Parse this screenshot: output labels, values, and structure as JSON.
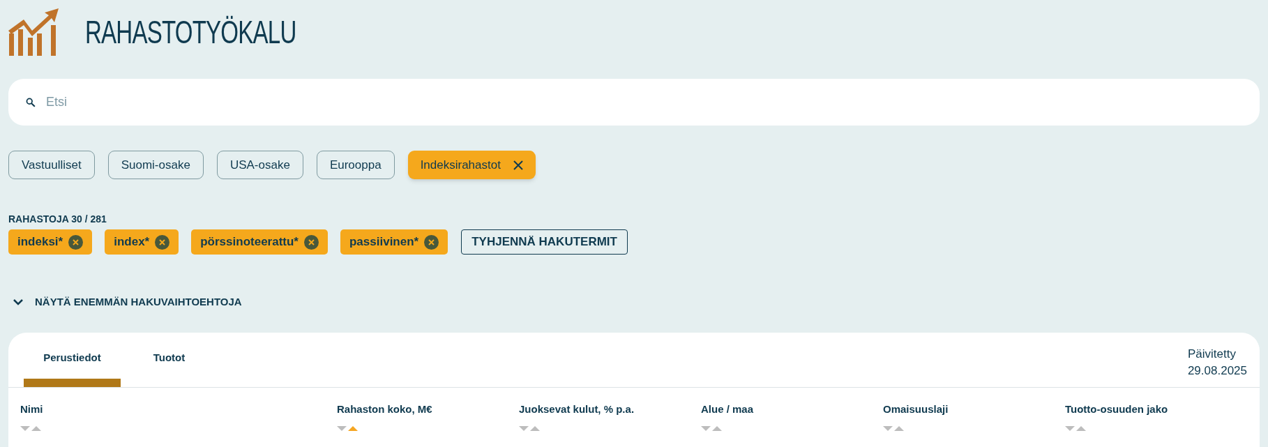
{
  "header": {
    "title": "RAHASTOTYÖKALU"
  },
  "search": {
    "placeholder": "Etsi"
  },
  "quick_filters": [
    {
      "label": "Vastuulliset",
      "selected": false
    },
    {
      "label": "Suomi-osake",
      "selected": false
    },
    {
      "label": "USA-osake",
      "selected": false
    },
    {
      "label": "Eurooppa",
      "selected": false
    },
    {
      "label": "Indeksirahastot",
      "selected": true
    }
  ],
  "result_count": "RAHASTOJA 30 / 281",
  "search_terms": [
    {
      "label": "indeksi*"
    },
    {
      "label": "index*"
    },
    {
      "label": "pörssinoteerattu*"
    },
    {
      "label": "passiivinen*"
    }
  ],
  "clear_button": "TYHJENNÄ HAKUTERMIT",
  "more_options": {
    "label": "NÄYTÄ ENEMMÄN HAKUVAIHTOEHTOJA",
    "expanded": false
  },
  "table": {
    "tabs": [
      {
        "label": "Perustiedot",
        "selected": true
      },
      {
        "label": "Tuotot",
        "selected": false
      }
    ],
    "updated_label": "Päivitetty",
    "updated_date": "29.08.2025",
    "columns": [
      {
        "label": "Nimi",
        "sorted_ascending": false
      },
      {
        "label": "Rahaston koko, M€",
        "sorted_ascending": true
      },
      {
        "label": "Juoksevat kulut, % p.a.",
        "sorted_ascending": false
      },
      {
        "label": "Alue / maa",
        "sorted_ascending": false
      },
      {
        "label": "Omaisuuslaji",
        "sorted_ascending": false
      },
      {
        "label": "Tuotto-osuuden jako",
        "sorted_ascending": false
      }
    ]
  }
}
